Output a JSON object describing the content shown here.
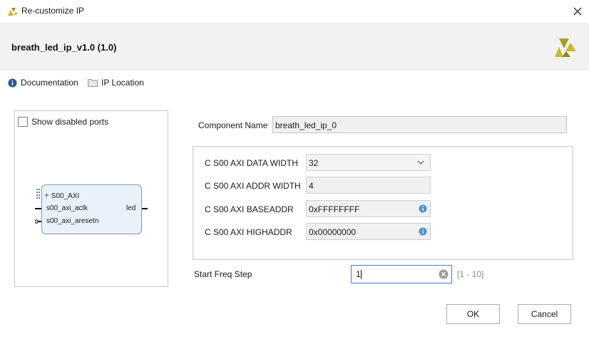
{
  "window": {
    "title": "Re-customize IP"
  },
  "header": {
    "ip_name": "breath_led_ip_v1.0 (1.0)"
  },
  "links": {
    "documentation": "Documentation",
    "ip_location": "IP Location"
  },
  "preview": {
    "show_disabled_ports": "Show disabled ports",
    "show_disabled_ports_checked": false,
    "block": {
      "bus_interface": "S00_AXI",
      "clock_port": "s00_axi_aclk",
      "reset_port": "s00_axi_aresetn",
      "output_port": "led"
    }
  },
  "component": {
    "label": "Component Name",
    "value": "breath_led_ip_0"
  },
  "params": [
    {
      "label": "C S00 AXI DATA WIDTH",
      "value": "32",
      "kind": "dropdown"
    },
    {
      "label": "C S00 AXI ADDR WIDTH",
      "value": "4",
      "kind": "text"
    },
    {
      "label": "C S00 AXI BASEADDR",
      "value": "0xFFFFFFFF",
      "kind": "info"
    },
    {
      "label": "C S00 AXI HIGHADDR",
      "value": "0x00000000",
      "kind": "info"
    }
  ],
  "freq": {
    "label": "Start Freq Step",
    "value": "1",
    "range": "[1 - 10]"
  },
  "buttons": {
    "ok": "OK",
    "cancel": "Cancel"
  },
  "colors": {
    "accent_blue": "#3f7fd0",
    "xilinx_yellow": "#c6ba2b",
    "info_blue": "#4a90d9"
  }
}
